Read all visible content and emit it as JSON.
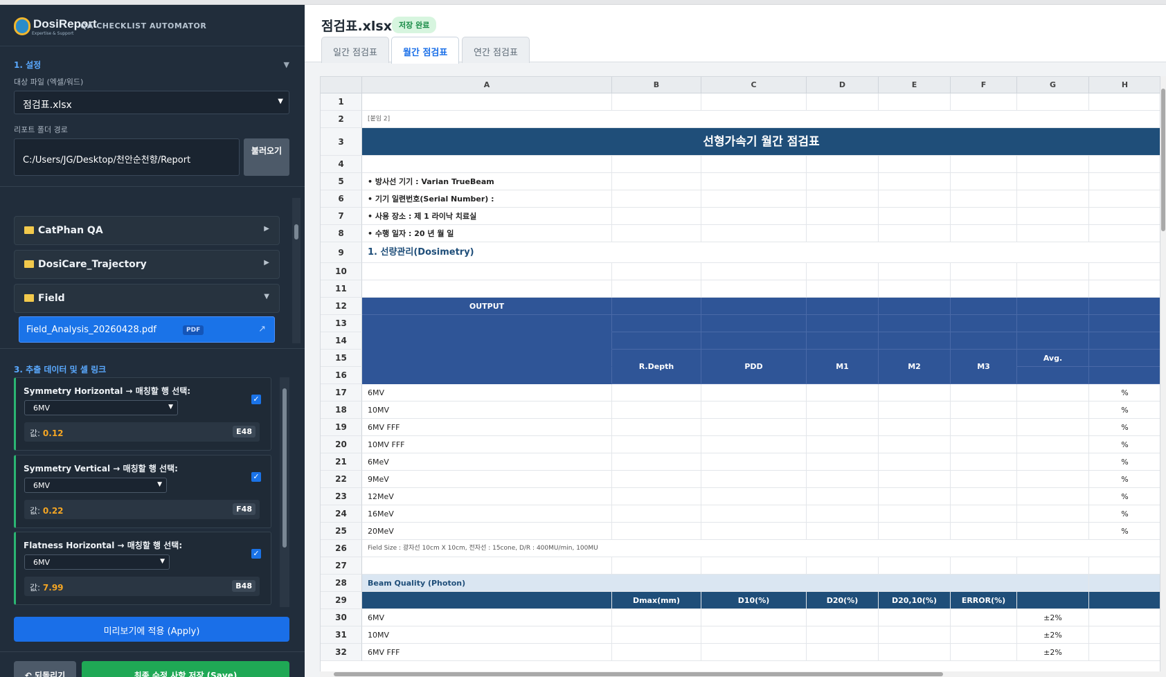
{
  "app": {
    "brand": "DosiReport",
    "brand_sub": "Expertise & Support",
    "name": "QA CHECKLIST AUTOMATOR"
  },
  "settings": {
    "header": "1. 설정",
    "target_label": "대상 파일 (엑셀/워드)",
    "target_value": "점검표.xlsx",
    "report_label": "리포트 폴더 경로",
    "report_path": "C:/Users/JG/Desktop/천안순천향/Report",
    "load_button": "불러오기"
  },
  "tree": {
    "folders": [
      "CatPhan QA",
      "DosiCare_Trajectory",
      "Field"
    ],
    "selected_file": "Field_Analysis_20260428.pdf",
    "file_badge": "PDF"
  },
  "extract": {
    "header": "3. 추출 데이터 및 셀 링크",
    "value_prefix": "값:",
    "cards": [
      {
        "title": "Symmetry Horizontal → 매칭할 행 선택:",
        "row": "6MV",
        "value": "0.12",
        "cell": "E48"
      },
      {
        "title": "Symmetry Vertical → 매칭할 행 선택:",
        "row": "6MV",
        "value": "0.22",
        "cell": "F48"
      },
      {
        "title": "Flatness Horizontal → 매칭할 행 선택:",
        "row": "6MV",
        "value": "7.99",
        "cell": "B48"
      }
    ]
  },
  "buttons": {
    "apply": "미리보기에 적용 (Apply)",
    "revert": "↶ 되돌리기",
    "save": "최종 수정 사항 저장 (Save)"
  },
  "file": {
    "title": "점검표.xlsx",
    "status": "저장 완료"
  },
  "tabs": [
    "일간 점검표",
    "월간 점검표",
    "연간 점검표"
  ],
  "sheet": {
    "columns": [
      "A",
      "B",
      "C",
      "D",
      "E",
      "F",
      "G",
      "H"
    ],
    "row_numbers": [
      "1",
      "2",
      "3",
      "4",
      "5",
      "6",
      "7",
      "8",
      "9",
      "10",
      "11",
      "12",
      "13",
      "14",
      "15",
      "16",
      "17",
      "18",
      "19",
      "20",
      "21",
      "22",
      "23",
      "24",
      "25",
      "26",
      "27",
      "28",
      "29",
      "30",
      "31",
      "32"
    ],
    "attachment": "[붙임 2]",
    "main_title": "선형가속기 월간 점검표",
    "info": [
      "• 방사선 기기 : Varian TrueBeam",
      "• 기기 일련번호(Serial Number) :",
      "• 사용 장소 : 제 1 라이낙 치료실",
      "• 수행 일자 : 20 년 월 일"
    ],
    "section1": "1. 선량관리(Dosimetry)",
    "output_label": "OUTPUT",
    "output_headers": [
      "R.Depth",
      "PDD",
      "M1",
      "M2",
      "M3",
      "Avg."
    ],
    "energies": [
      "6MV",
      "10MV",
      "6MV FFF",
      "10MV FFF",
      "6MeV",
      "9MeV",
      "12MeV",
      "16MeV",
      "20MeV"
    ],
    "percent": "%",
    "field_note": "Field Size : 광자선 10cm X 10cm, 전자선 : 15cone, D/R : 400MU/min, 100MU",
    "beam_quality": "Beam Quality (Photon)",
    "bq_headers": [
      "Dmax(mm)",
      "D10(%)",
      "D20(%)",
      "D20,10(%)",
      "ERROR(%)"
    ],
    "bq_rows": [
      "6MV",
      "10MV",
      "6MV FFF"
    ],
    "tolerance": "±2%"
  }
}
